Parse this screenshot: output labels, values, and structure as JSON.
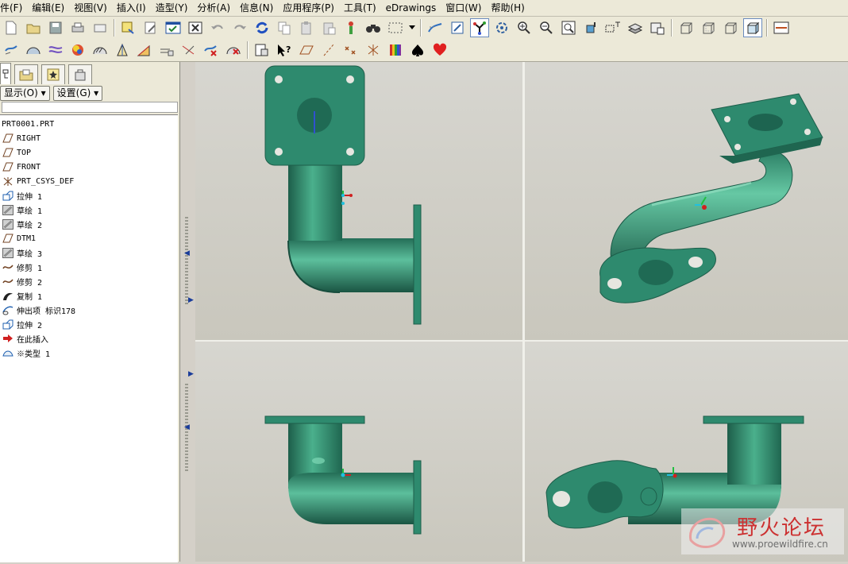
{
  "menubar": {
    "items": [
      "件(F)",
      "编辑(E)",
      "视图(V)",
      "插入(I)",
      "造型(Y)",
      "分析(A)",
      "信息(N)",
      "应用程序(P)",
      "工具(T)",
      "eDrawings",
      "窗口(W)",
      "帮助(H)"
    ]
  },
  "panel": {
    "show_button": "显示(O) ▾",
    "settings_button": "设置(G) ▾"
  },
  "model_tree": {
    "items": [
      {
        "label": "PRT0001.PRT",
        "icon": "part-icon"
      },
      {
        "label": "RIGHT",
        "icon": "datum-plane-icon"
      },
      {
        "label": "TOP",
        "icon": "datum-plane-icon"
      },
      {
        "label": "FRONT",
        "icon": "datum-plane-icon"
      },
      {
        "label": "PRT_CSYS_DEF",
        "icon": "csys-icon"
      },
      {
        "label": "拉伸 1",
        "icon": "extrude-icon"
      },
      {
        "label": "草绘 1",
        "icon": "sketch-icon"
      },
      {
        "label": "草绘 2",
        "icon": "sketch-icon"
      },
      {
        "label": "DTM1",
        "icon": "datum-plane-icon"
      },
      {
        "label": "草绘 3",
        "icon": "sketch-icon"
      },
      {
        "label": "修剪 1",
        "icon": "trim-icon"
      },
      {
        "label": "修剪 2",
        "icon": "trim-icon"
      },
      {
        "label": "复制 1",
        "icon": "copy-icon"
      },
      {
        "label": "伸出项 标识178",
        "icon": "protrusion-icon"
      },
      {
        "label": "拉伸 2",
        "icon": "extrude-icon"
      },
      {
        "label": "在此插入",
        "icon": "insert-here-icon"
      },
      {
        "label": "※类型 1",
        "icon": "type-icon"
      }
    ]
  },
  "watermark": {
    "title": "野火论坛",
    "url": "www.proewildfire.cn"
  },
  "colors": {
    "model": "#2e8a6e",
    "model_dark": "#1d5e4a",
    "model_light": "#5cbf9c",
    "viewport_bg": "#d0cfc7"
  }
}
